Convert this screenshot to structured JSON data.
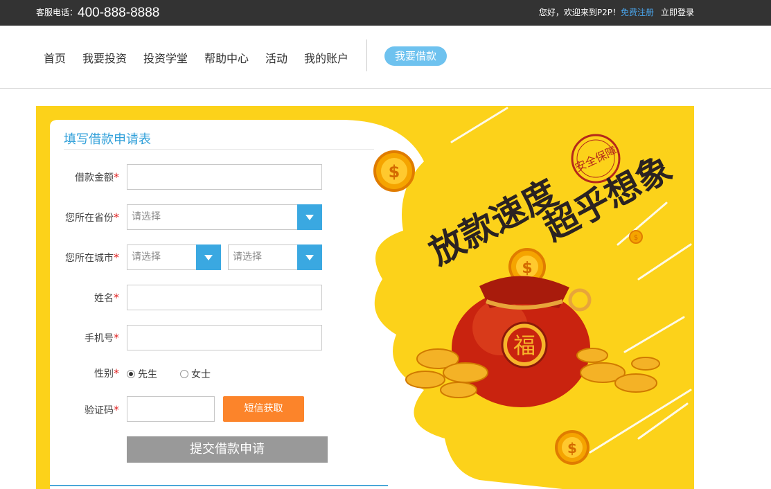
{
  "topbar": {
    "hotline_label": "客服电话：",
    "hotline_number": "400-888-8888",
    "welcome": "您好，欢迎来到P2P！",
    "register": "免费注册",
    "login": "立即登录"
  },
  "nav": {
    "items": [
      "首页",
      "我要投资",
      "投资学堂",
      "帮助中心",
      "活动",
      "我的账户"
    ],
    "borrow": "我要借款"
  },
  "form": {
    "title": "填写借款申请表",
    "amount_label": "借款金额",
    "province_label": "您所在省份",
    "province_placeholder": "请选择",
    "city_label": "您所在城市",
    "city_placeholder": "请选择",
    "district_placeholder": "请选择",
    "name_label": "姓名",
    "phone_label": "手机号",
    "gender_label": "性别",
    "gender_options": [
      "先生",
      "女士"
    ],
    "gender_selected": "先生",
    "code_label": "验证码",
    "sms_button": "短信获取",
    "submit": "提交借款申请",
    "required_mark": "*"
  },
  "banner": {
    "headline_1": "放款速度",
    "headline_2": "超乎想象",
    "seal": "安全保障",
    "bag_char": "福",
    "colors": {
      "background": "#fcd21a",
      "coin": "#f5a400",
      "bag": "#c9230f"
    }
  }
}
